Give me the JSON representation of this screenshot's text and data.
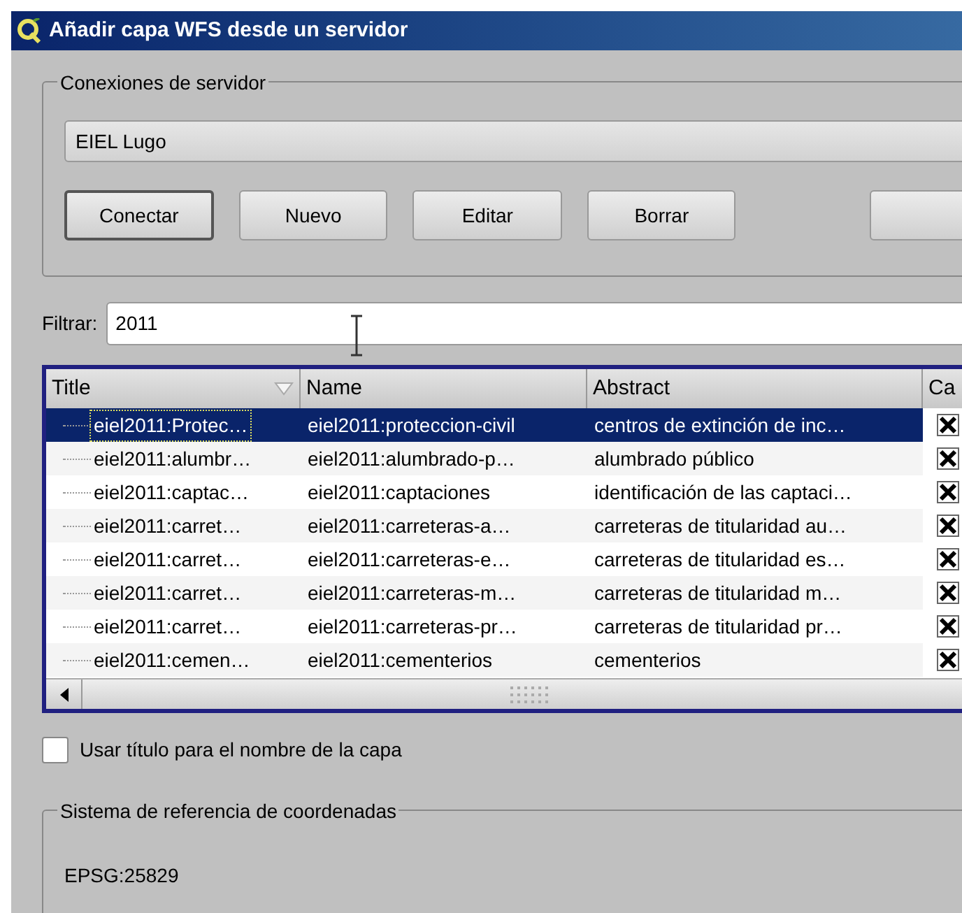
{
  "window": {
    "title": "Añadir capa WFS desde un servidor"
  },
  "server_connections": {
    "label": "Conexiones de servidor",
    "selected_connection": "EIEL Lugo",
    "buttons": [
      {
        "label": "Conectar",
        "default": true
      },
      {
        "label": "Nuevo",
        "default": false
      },
      {
        "label": "Editar",
        "default": false
      },
      {
        "label": "Borrar",
        "default": false
      }
    ]
  },
  "filter": {
    "label": "Filtrar:",
    "value": "2011"
  },
  "table": {
    "columns": [
      {
        "label": "Title",
        "sorted": true
      },
      {
        "label": "Name"
      },
      {
        "label": "Abstract"
      },
      {
        "label": "Ca"
      }
    ],
    "rows": [
      {
        "title": "eiel2011:Protec…",
        "name": "eiel2011:proteccion-civil",
        "abstract": "centros de extinción de inc…",
        "checked": true,
        "selected": true
      },
      {
        "title": "eiel2011:alumbr…",
        "name": "eiel2011:alumbrado-p…",
        "abstract": "alumbrado público",
        "checked": true,
        "selected": false
      },
      {
        "title": "eiel2011:captac…",
        "name": "eiel2011:captaciones",
        "abstract": "identificación de las captaci…",
        "checked": true,
        "selected": false
      },
      {
        "title": "eiel2011:carret…",
        "name": "eiel2011:carreteras-a…",
        "abstract": "carreteras de titularidad au…",
        "checked": true,
        "selected": false
      },
      {
        "title": "eiel2011:carret…",
        "name": "eiel2011:carreteras-e…",
        "abstract": "carreteras de titularidad es…",
        "checked": true,
        "selected": false
      },
      {
        "title": "eiel2011:carret…",
        "name": "eiel2011:carreteras-m…",
        "abstract": "carreteras de titularidad m…",
        "checked": true,
        "selected": false
      },
      {
        "title": "eiel2011:carret…",
        "name": "eiel2011:carreteras-pr…",
        "abstract": "carreteras de titularidad pr…",
        "checked": true,
        "selected": false
      },
      {
        "title": "eiel2011:cemen…",
        "name": "eiel2011:cementerios",
        "abstract": "cementerios",
        "checked": true,
        "selected": false
      }
    ]
  },
  "use_title_checkbox": {
    "label": "Usar título para el nombre de la capa",
    "checked": false
  },
  "crs": {
    "label": "Sistema de referencia de coordenadas",
    "value": "EPSG:25829"
  }
}
